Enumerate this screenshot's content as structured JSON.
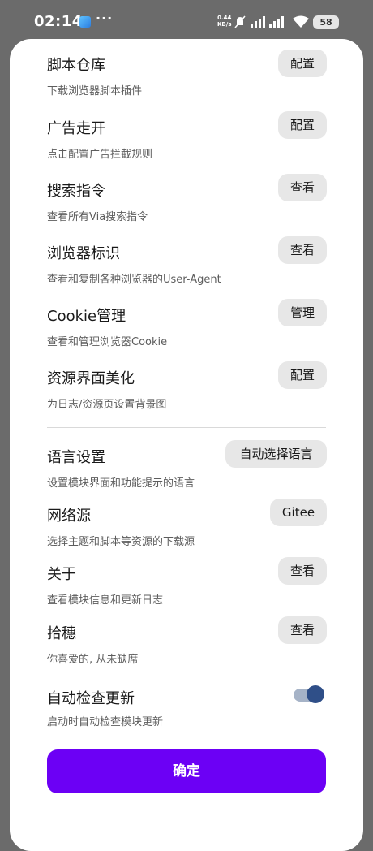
{
  "status_bar": {
    "time": "02:14",
    "more": "···",
    "net_speed_value": "0.44",
    "net_speed_unit": "KB/s",
    "battery": "58"
  },
  "items": [
    {
      "title": "脚本仓库",
      "subtitle": "下载浏览器脚本插件",
      "button": "配置"
    },
    {
      "title": "广告走开",
      "subtitle": "点击配置广告拦截规则",
      "button": "配置"
    },
    {
      "title": "搜索指令",
      "subtitle": "查看所有Via搜索指令",
      "button": "查看"
    },
    {
      "title": "浏览器标识",
      "subtitle": "查看和复制各种浏览器的User-Agent",
      "button": "查看"
    },
    {
      "title": "Cookie管理",
      "subtitle": "查看和管理浏览器Cookie",
      "button": "管理"
    },
    {
      "title": "资源界面美化",
      "subtitle": "为日志/资源页设置背景图",
      "button": "配置"
    },
    {
      "title": "语言设置",
      "subtitle": "设置模块界面和功能提示的语言",
      "button": "自动选择语言"
    },
    {
      "title": "网络源",
      "subtitle": "选择主题和脚本等资源的下载源",
      "button": "Gitee"
    },
    {
      "title": "关于",
      "subtitle": "查看模块信息和更新日志",
      "button": "查看"
    },
    {
      "title": "拾穗",
      "subtitle": "你喜爱的, 从未缺席",
      "button": "查看"
    },
    {
      "title": "自动检查更新",
      "subtitle": "启动时自动检查模块更新",
      "toggle_on": true
    }
  ],
  "confirm_label": "确定",
  "colors": {
    "accent": "#6c00f5",
    "pill_bg": "#e7e7e7",
    "toggle_knob": "#2f4f88"
  }
}
